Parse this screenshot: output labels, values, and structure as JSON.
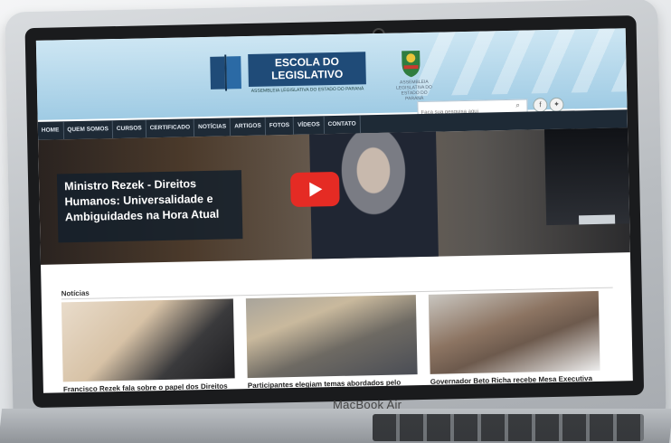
{
  "site": {
    "logo_title": "ESCOLA DO LEGISLATIVO",
    "logo_subtitle": "ASSEMBLEIA LEGISLATIVA DO ESTADO DO PARANÁ",
    "crest_text": "ASSEMBLEIA LEGISLATIVA DO ESTADO DO PARANÁ",
    "search_placeholder": "Faça sua pesquisa aqui",
    "nav": [
      "HOME",
      "QUEM SOMOS",
      "CURSOS",
      "CERTIFICADO",
      "NOTÍCIAS",
      "ARTIGOS",
      "FOTOS",
      "VÍDEOS",
      "CONTATO"
    ]
  },
  "hero": {
    "caption": "Ministro Rezek - Direitos Humanos: Universalidade e Ambiguidades na Hora Atual"
  },
  "news": {
    "title": "Notícias",
    "items": [
      {
        "caption": "Francisco Rezek fala sobre o papel dos Direitos Humanos num mundo conflagrado por conflitos"
      },
      {
        "caption": "Participantes elegiam temas abordados pelo ministro Rezek durante palestra"
      },
      {
        "caption": "Governador Beto Richa recebe Mesa Executiva do Parlamento Universitário"
      }
    ]
  },
  "device": {
    "brand": "MacBook Air"
  },
  "colors": {
    "nav_bg": "#1e2a36",
    "logo_bg": "#1f4b78",
    "play_red": "#e52b24"
  }
}
